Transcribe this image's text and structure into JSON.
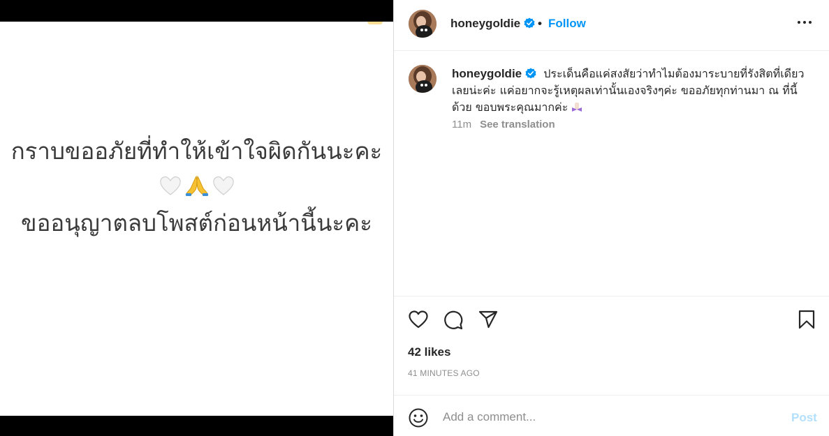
{
  "media": {
    "line1": "กราบขออภัยที่ทำให้เข้าใจผิดกันนะคะ",
    "emoji": [
      "white-heart",
      "folded-hands",
      "white-heart"
    ],
    "line2": "ขออนุญาตลบโพสต์ก่อนหน้านี้นะคะ"
  },
  "header": {
    "username": "honeygoldie",
    "separator": "•",
    "follow_label": "Follow"
  },
  "caption": {
    "username": "honeygoldie",
    "text": "ประเด็นคือแค่สงสัยว่าทำไมต้องมาระบายที่รังสิตที่เดียวเลยน่ะค่ะ แค่อยากจะรู้เหตุผลเท่านั้นเองจริงๆค่ะ ขออภัยทุกท่านมา ณ ที่นี้ด้วย ขอบพระคุณมากค่ะ",
    "trailing_emoji": "bow-emoji",
    "age": "11m",
    "see_translation": "See translation"
  },
  "actions": {
    "likes": "42 likes",
    "time_ago": "41 MINUTES AGO"
  },
  "comment": {
    "placeholder": "Add a comment...",
    "post_label": "Post"
  },
  "colors": {
    "accent": "#0095f6",
    "post_disabled": "#b2dffc",
    "muted": "#8e8e8e",
    "text": "#262626"
  }
}
